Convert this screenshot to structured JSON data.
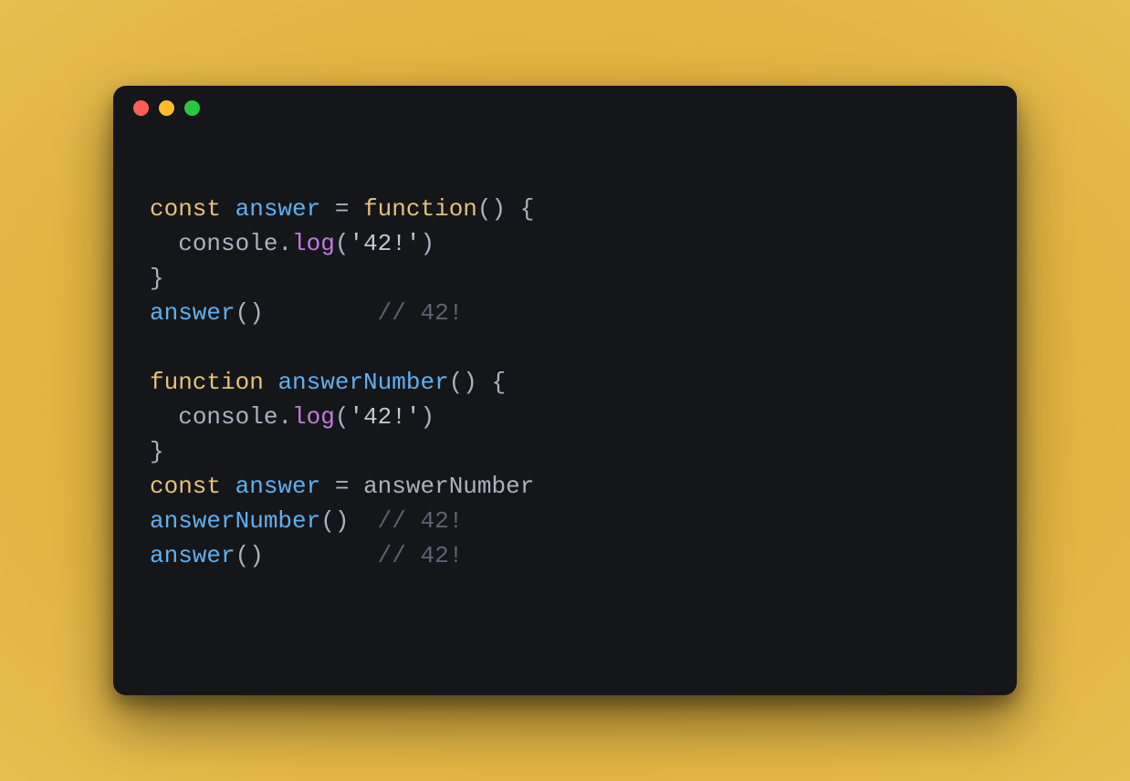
{
  "code": {
    "lines": [
      {
        "parts": [
          {
            "cls": "kw",
            "t": "const"
          },
          {
            "cls": "",
            "t": " "
          },
          {
            "cls": "id",
            "t": "answer"
          },
          {
            "cls": "",
            "t": " "
          },
          {
            "cls": "op",
            "t": "="
          },
          {
            "cls": "",
            "t": " "
          },
          {
            "cls": "kw",
            "t": "function"
          },
          {
            "cls": "par",
            "t": "()"
          },
          {
            "cls": "",
            "t": " "
          },
          {
            "cls": "par",
            "t": "{"
          }
        ]
      },
      {
        "parts": [
          {
            "cls": "",
            "t": "  "
          },
          {
            "cls": "pl",
            "t": "console"
          },
          {
            "cls": "par",
            "t": "."
          },
          {
            "cls": "fn",
            "t": "log"
          },
          {
            "cls": "par",
            "t": "("
          },
          {
            "cls": "str",
            "t": "'42!'"
          },
          {
            "cls": "par",
            "t": ")"
          }
        ]
      },
      {
        "parts": [
          {
            "cls": "par",
            "t": "}"
          }
        ]
      },
      {
        "parts": [
          {
            "cls": "id",
            "t": "answer"
          },
          {
            "cls": "par",
            "t": "()"
          },
          {
            "cls": "",
            "t": "        "
          },
          {
            "cls": "cmt",
            "t": "// 42!"
          }
        ]
      },
      {
        "parts": [
          {
            "cls": "",
            "t": ""
          }
        ]
      },
      {
        "parts": [
          {
            "cls": "kw",
            "t": "function"
          },
          {
            "cls": "",
            "t": " "
          },
          {
            "cls": "id",
            "t": "answerNumber"
          },
          {
            "cls": "par",
            "t": "()"
          },
          {
            "cls": "",
            "t": " "
          },
          {
            "cls": "par",
            "t": "{"
          }
        ]
      },
      {
        "parts": [
          {
            "cls": "",
            "t": "  "
          },
          {
            "cls": "pl",
            "t": "console"
          },
          {
            "cls": "par",
            "t": "."
          },
          {
            "cls": "fn",
            "t": "log"
          },
          {
            "cls": "par",
            "t": "("
          },
          {
            "cls": "str",
            "t": "'42!'"
          },
          {
            "cls": "par",
            "t": ")"
          }
        ]
      },
      {
        "parts": [
          {
            "cls": "par",
            "t": "}"
          }
        ]
      },
      {
        "parts": [
          {
            "cls": "kw",
            "t": "const"
          },
          {
            "cls": "",
            "t": " "
          },
          {
            "cls": "id",
            "t": "answer"
          },
          {
            "cls": "",
            "t": " "
          },
          {
            "cls": "op",
            "t": "="
          },
          {
            "cls": "",
            "t": " "
          },
          {
            "cls": "pl",
            "t": "answerNumber"
          }
        ]
      },
      {
        "parts": [
          {
            "cls": "id",
            "t": "answerNumber"
          },
          {
            "cls": "par",
            "t": "()"
          },
          {
            "cls": "",
            "t": "  "
          },
          {
            "cls": "cmt",
            "t": "// 42!"
          }
        ]
      },
      {
        "parts": [
          {
            "cls": "id",
            "t": "answer"
          },
          {
            "cls": "par",
            "t": "()"
          },
          {
            "cls": "",
            "t": "        "
          },
          {
            "cls": "cmt",
            "t": "// 42!"
          }
        ]
      }
    ]
  }
}
